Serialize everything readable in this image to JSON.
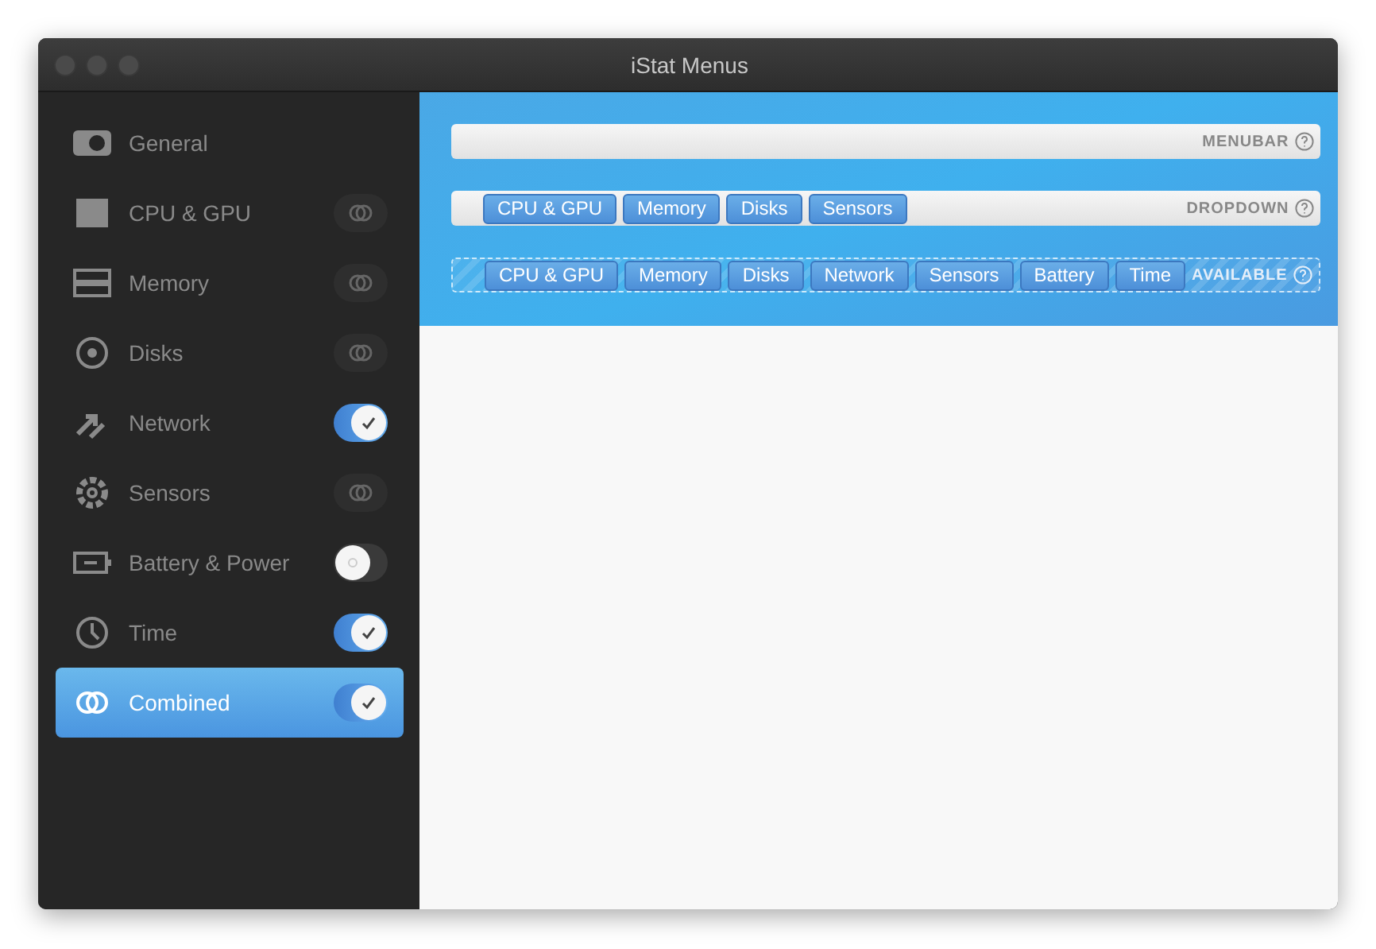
{
  "window": {
    "title": "iStat Menus"
  },
  "sidebar": {
    "items": [
      {
        "label": "General",
        "kind": "plain",
        "selected": false
      },
      {
        "label": "CPU & GPU",
        "kind": "combine",
        "selected": false
      },
      {
        "label": "Memory",
        "kind": "combine",
        "selected": false
      },
      {
        "label": "Disks",
        "kind": "combine",
        "selected": false
      },
      {
        "label": "Network",
        "kind": "switch",
        "on": true,
        "selected": false
      },
      {
        "label": "Sensors",
        "kind": "combine",
        "selected": false
      },
      {
        "label": "Battery & Power",
        "kind": "switch",
        "on": false,
        "selected": false
      },
      {
        "label": "Time",
        "kind": "switch",
        "on": true,
        "selected": false
      },
      {
        "label": "Combined",
        "kind": "switch",
        "on": true,
        "selected": true
      }
    ]
  },
  "zones": [
    {
      "label": "MENUBAR",
      "kind": "solid"
    },
    {
      "label": "DROPDOWN",
      "kind": "solid",
      "items": [
        "CPU & GPU",
        "Memory",
        "Disks",
        "Sensors"
      ]
    },
    {
      "label": "AVAILABLE",
      "kind": "dashed",
      "items": [
        "CPU & GPU",
        "Memory",
        "Disks",
        "Network",
        "Sensors",
        "Battery",
        "Time"
      ]
    }
  ]
}
